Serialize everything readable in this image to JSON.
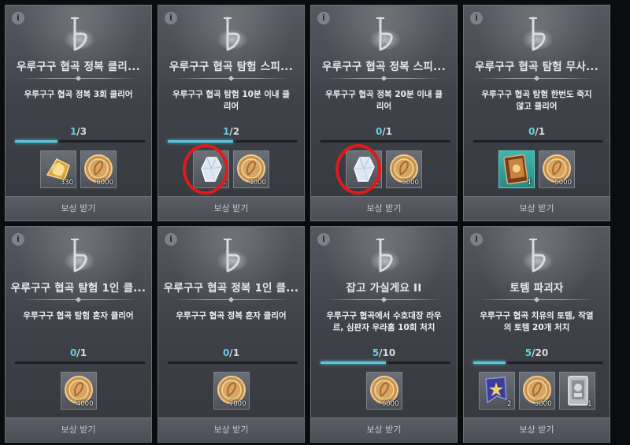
{
  "claim_label": "보상 받기",
  "cards": [
    {
      "title": "우루구구 협곡 정복 클리...",
      "desc": "우루구구 협곡 정복 3회 클리어",
      "cur": "1",
      "total": "3",
      "progress": 0.333,
      "rewards": [
        {
          "icon": "gold-shard-icon",
          "qty": "330"
        },
        {
          "icon": "gold-coin-icon",
          "qty": "6000"
        }
      ]
    },
    {
      "title": "우루구구 협곡 탐험 스피...",
      "desc": "우루구구 협곡 탐험 10분 이내 클리어",
      "cur": "1",
      "total": "2",
      "progress": 0.5,
      "rewards": [
        {
          "icon": "crystal-icon",
          "qty": "1"
        },
        {
          "icon": "gold-coin-icon",
          "qty": "4000"
        }
      ]
    },
    {
      "title": "우루구구 협곡 정복 스피...",
      "desc": "우루구구 협곡 정복 20분 이내 클리어",
      "cur": "0",
      "total": "1",
      "progress": 0,
      "rewards": [
        {
          "icon": "crystal-icon",
          "qty": "1"
        },
        {
          "icon": "gold-coin-icon",
          "qty": "5000"
        }
      ]
    },
    {
      "title": "우루구구 협곡 탐험 무사...",
      "desc": "우루구구 협곡 탐험 한번도 죽지 않고 클리어",
      "cur": "0",
      "total": "1",
      "progress": 0,
      "rewards": [
        {
          "icon": "card-pack-icon",
          "qty": "1"
        },
        {
          "icon": "gold-coin-icon",
          "qty": "5000"
        }
      ]
    },
    {
      "title": "우루구구 협곡 탐험 1인 클...",
      "desc": "우루구구 협곡 탐험 혼자 클리어",
      "cur": "0",
      "total": "1",
      "progress": 0,
      "rewards": [
        {
          "icon": "gold-coin-icon",
          "qty": "4000"
        }
      ]
    },
    {
      "title": "우루구구 협곡 정복 1인 클...",
      "desc": "우루구구 협곡 정복 혼자 클리어",
      "cur": "0",
      "total": "1",
      "progress": 0,
      "rewards": [
        {
          "icon": "gold-coin-icon",
          "qty": "7000"
        }
      ]
    },
    {
      "title": "잡고 가실게요 II",
      "desc": "우루구구 협곡에서 수호대장 라우르, 심판자 우라홈 10회 처치",
      "cur": "5",
      "total": "10",
      "progress": 0.5,
      "rewards": [
        {
          "icon": "gold-coin-icon",
          "qty": "6000"
        }
      ]
    },
    {
      "title": "토템 파괴자",
      "desc": "우루구구 협곡 치유의 토템, 작열의 토템 20개 처치",
      "cur": "5",
      "total": "20",
      "progress": 0.25,
      "rewards": [
        {
          "icon": "scroll-banner-icon",
          "qty": "2"
        },
        {
          "icon": "gold-coin-icon",
          "qty": "3000"
        },
        {
          "icon": "silver-card-icon",
          "qty": "1"
        }
      ]
    }
  ]
}
